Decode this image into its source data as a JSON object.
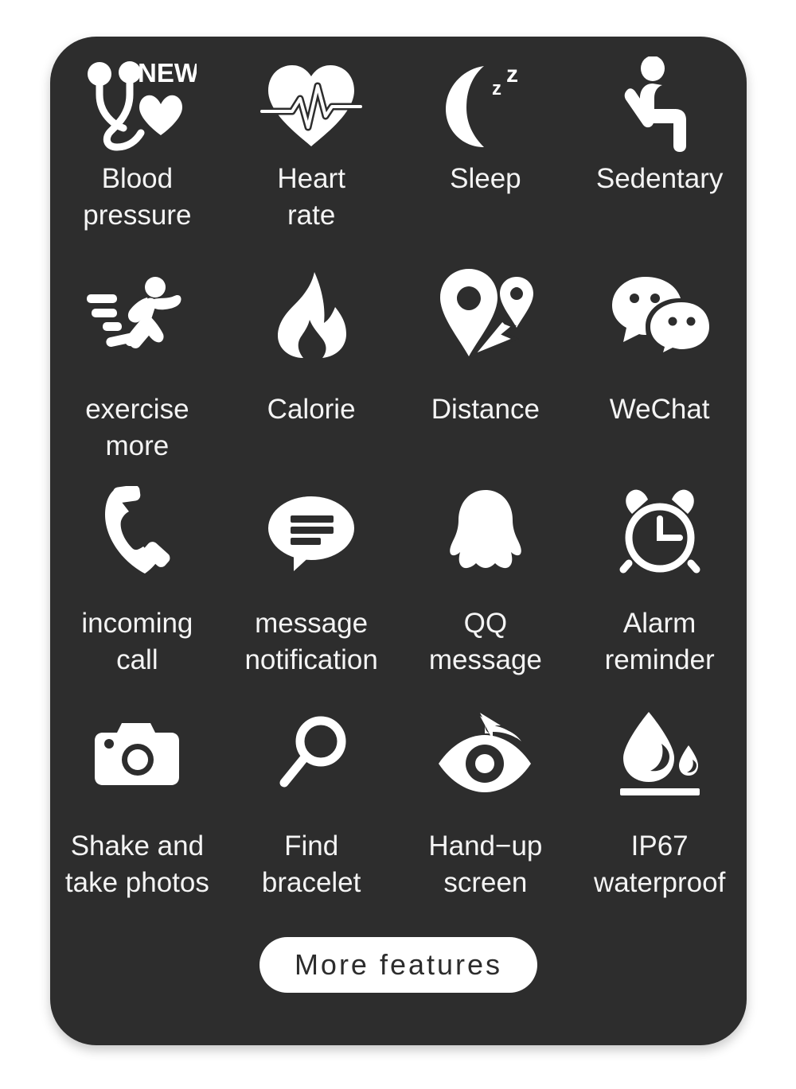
{
  "card": {
    "background_color": "#2d2d2d",
    "page_background_color": "#ffffff",
    "label_color": "#f4f4f4"
  },
  "badges": {
    "new": "NEW"
  },
  "features": [
    {
      "icon": "stethoscope-heart-icon",
      "label": "Blood\npressure",
      "badge": "NEW"
    },
    {
      "icon": "heart-pulse-icon",
      "label": "Heart\nrate"
    },
    {
      "icon": "moon-zzz-icon",
      "label": "Sleep"
    },
    {
      "icon": "person-sitting-icon",
      "label": "Sedentary"
    },
    {
      "icon": "running-person-icon",
      "label": "exercise\nmore"
    },
    {
      "icon": "flame-icon",
      "label": "Calorie"
    },
    {
      "icon": "map-pins-route-icon",
      "label": "Distance"
    },
    {
      "icon": "wechat-bubbles-icon",
      "label": "WeChat"
    },
    {
      "icon": "phone-handset-icon",
      "label": "incoming\ncall"
    },
    {
      "icon": "speech-bubble-lines-icon",
      "label": "message\nnotification"
    },
    {
      "icon": "qq-penguin-icon",
      "label": "QQ\nmessage"
    },
    {
      "icon": "alarm-clock-icon",
      "label": "Alarm\nreminder"
    },
    {
      "icon": "camera-icon",
      "label": "Shake and\ntake photos"
    },
    {
      "icon": "magnifier-icon",
      "label": "Find\nbracelet"
    },
    {
      "icon": "eye-raise-arrow-icon",
      "label": "Hand−up\nscreen"
    },
    {
      "icon": "water-drop-icon",
      "label": "IP67\nwaterproof"
    }
  ],
  "more_button": {
    "label": "More features"
  }
}
